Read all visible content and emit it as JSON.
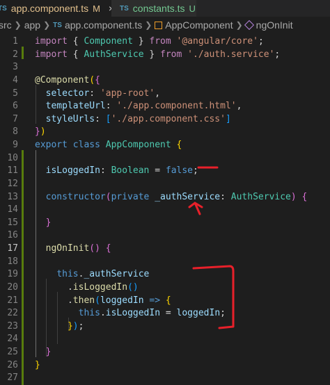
{
  "tabs": [
    {
      "badge": "TS",
      "name": "app.component.ts",
      "status": "M",
      "close": "×"
    },
    {
      "badge": "TS",
      "name": "constants.ts",
      "status": "U"
    }
  ],
  "breadcrumb": {
    "items": [
      "src",
      "app",
      "app.component.ts",
      "AppComponent",
      "ngOnInit"
    ],
    "badge": "TS"
  },
  "lines": [
    {
      "n": "1",
      "tokens": [
        [
          "kw",
          "import"
        ],
        [
          "punc",
          " { "
        ],
        [
          "cls",
          "Component"
        ],
        [
          "punc",
          " } "
        ],
        [
          "kw",
          "from"
        ],
        [
          "punc",
          " "
        ],
        [
          "str",
          "'@angular/core'"
        ],
        [
          "punc",
          ";"
        ]
      ]
    },
    {
      "n": "2",
      "tokens": [
        [
          "kw",
          "import"
        ],
        [
          "punc",
          " { "
        ],
        [
          "cls",
          "AuthService"
        ],
        [
          "punc",
          " } "
        ],
        [
          "kw",
          "from"
        ],
        [
          "punc",
          " "
        ],
        [
          "str",
          "'./auth.service'"
        ],
        [
          "punc",
          ";"
        ]
      ]
    },
    {
      "n": "3",
      "tokens": []
    },
    {
      "n": "4",
      "tokens": [
        [
          "dec",
          "@"
        ],
        [
          "dec",
          "Component"
        ],
        [
          "brk1",
          "("
        ],
        [
          "brk2",
          "{"
        ]
      ]
    },
    {
      "n": "5",
      "tokens": [
        [
          "punc",
          "  "
        ],
        [
          "prop",
          "selector"
        ],
        [
          "punc",
          ": "
        ],
        [
          "str",
          "'app-root'"
        ],
        [
          "punc",
          ","
        ]
      ]
    },
    {
      "n": "6",
      "tokens": [
        [
          "punc",
          "  "
        ],
        [
          "prop",
          "templateUrl"
        ],
        [
          "punc",
          ": "
        ],
        [
          "str",
          "'./app.component.html'"
        ],
        [
          "punc",
          ","
        ]
      ]
    },
    {
      "n": "7",
      "tokens": [
        [
          "punc",
          "  "
        ],
        [
          "prop",
          "styleUrls"
        ],
        [
          "punc",
          ": "
        ],
        [
          "brk3",
          "["
        ],
        [
          "str",
          "'./app.component.css'"
        ],
        [
          "brk3",
          "]"
        ]
      ]
    },
    {
      "n": "8",
      "tokens": [
        [
          "brk2",
          "}"
        ],
        [
          "brk1",
          ")"
        ]
      ]
    },
    {
      "n": "9",
      "tokens": [
        [
          "kw2",
          "export"
        ],
        [
          "punc",
          " "
        ],
        [
          "kw2",
          "class"
        ],
        [
          "punc",
          " "
        ],
        [
          "cls",
          "AppComponent"
        ],
        [
          "punc",
          " "
        ],
        [
          "brk1",
          "{"
        ]
      ]
    },
    {
      "n": "10",
      "tokens": []
    },
    {
      "n": "11",
      "tokens": [
        [
          "punc",
          "  "
        ],
        [
          "prop",
          "isLoggedIn"
        ],
        [
          "punc",
          ": "
        ],
        [
          "cls",
          "Boolean"
        ],
        [
          "punc",
          " = "
        ],
        [
          "kw2",
          "false"
        ],
        [
          "punc",
          ";"
        ]
      ]
    },
    {
      "n": "12",
      "tokens": []
    },
    {
      "n": "13",
      "tokens": [
        [
          "punc",
          "  "
        ],
        [
          "kw2",
          "constructor"
        ],
        [
          "brk2",
          "("
        ],
        [
          "kw2",
          "private"
        ],
        [
          "punc",
          " "
        ],
        [
          "prop",
          "_authService"
        ],
        [
          "punc",
          ": "
        ],
        [
          "cls",
          "AuthService"
        ],
        [
          "brk2",
          ")"
        ],
        [
          "punc",
          " "
        ],
        [
          "brk2",
          "{"
        ]
      ]
    },
    {
      "n": "14",
      "tokens": []
    },
    {
      "n": "15",
      "tokens": [
        [
          "punc",
          "  "
        ],
        [
          "brk2",
          "}"
        ]
      ]
    },
    {
      "n": "16",
      "tokens": []
    },
    {
      "n": "17",
      "tokens": [
        [
          "punc",
          "  "
        ],
        [
          "fn",
          "ngOnInit"
        ],
        [
          "brk2",
          "()"
        ],
        [
          "punc",
          " "
        ],
        [
          "brk2",
          "{"
        ]
      ]
    },
    {
      "n": "18",
      "tokens": []
    },
    {
      "n": "19",
      "tokens": [
        [
          "punc",
          "    "
        ],
        [
          "kw2",
          "this"
        ],
        [
          "punc",
          "."
        ],
        [
          "prop",
          "_authService"
        ]
      ]
    },
    {
      "n": "20",
      "tokens": [
        [
          "punc",
          "      ."
        ],
        [
          "fn",
          "isLoggedIn"
        ],
        [
          "brk3",
          "()"
        ]
      ]
    },
    {
      "n": "21",
      "tokens": [
        [
          "punc",
          "      ."
        ],
        [
          "fn",
          "then"
        ],
        [
          "brk3",
          "("
        ],
        [
          "prop",
          "loggedIn"
        ],
        [
          "punc",
          " "
        ],
        [
          "kw2",
          "=>"
        ],
        [
          "punc",
          " "
        ],
        [
          "brk1",
          "{"
        ]
      ]
    },
    {
      "n": "22",
      "tokens": [
        [
          "punc",
          "        "
        ],
        [
          "kw2",
          "this"
        ],
        [
          "punc",
          "."
        ],
        [
          "prop",
          "isLoggedIn"
        ],
        [
          "punc",
          " = "
        ],
        [
          "prop",
          "loggedIn"
        ],
        [
          "punc",
          ";"
        ]
      ]
    },
    {
      "n": "23",
      "tokens": [
        [
          "punc",
          "      "
        ],
        [
          "brk1",
          "}"
        ],
        [
          "brk3",
          ")"
        ],
        [
          "punc",
          ";"
        ]
      ]
    },
    {
      "n": "24",
      "tokens": []
    },
    {
      "n": "25",
      "tokens": [
        [
          "punc",
          "  "
        ],
        [
          "brk2",
          "}"
        ]
      ]
    },
    {
      "n": "26",
      "tokens": [
        [
          "brk1",
          "}"
        ]
      ]
    },
    {
      "n": "27",
      "tokens": []
    }
  ],
  "active_line": "17",
  "colors": {
    "annotation": "#e8202a",
    "added": "#587c0c"
  }
}
